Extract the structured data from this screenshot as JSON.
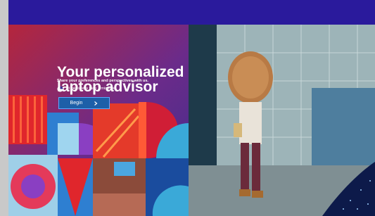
{
  "hero": {
    "title": "Your personalized laptop advisor",
    "subtitle": "Share your preferences and perspectives with us.",
    "time_note": "It takes less than 3 minutes",
    "begin_label": "Begin"
  }
}
